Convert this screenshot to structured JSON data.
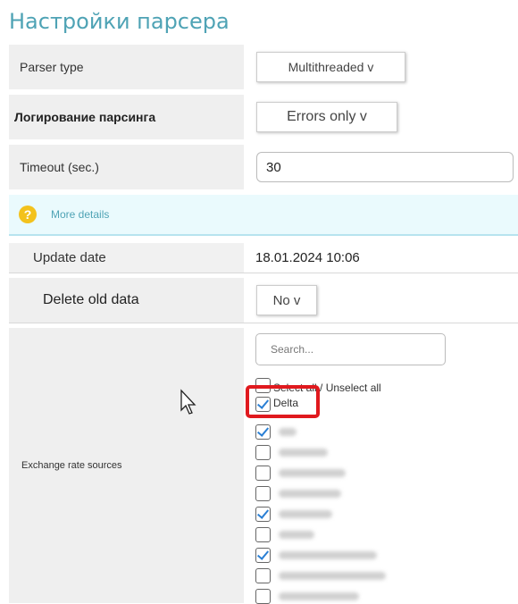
{
  "page_title": "Настройки парсера",
  "rows": {
    "parser_type": {
      "label": "Parser type",
      "value": "Multithreaded v"
    },
    "logging": {
      "label": "Логирование парсинга",
      "value": "Errors only v"
    },
    "timeout": {
      "label": "Timeout (sec.)",
      "value": "30"
    },
    "update_date": {
      "label": "Update date",
      "value": "18.01.2024 10:06"
    },
    "delete_old": {
      "label": "Delete old data",
      "value": "No v"
    },
    "sources": {
      "label": "Exchange rate sources"
    }
  },
  "more_details": "More details",
  "sources_list": {
    "search_placeholder": "Search...",
    "select_all": "Select all / Unselect all",
    "delta": "Delta",
    "checked_states": [
      true,
      false,
      false,
      false,
      true,
      false,
      true,
      false,
      false,
      false
    ]
  },
  "colors": {
    "title": "#4fa3b5",
    "highlight": "#e0191e",
    "check": "#2a7fd4",
    "info_bg": "#eafafd"
  }
}
